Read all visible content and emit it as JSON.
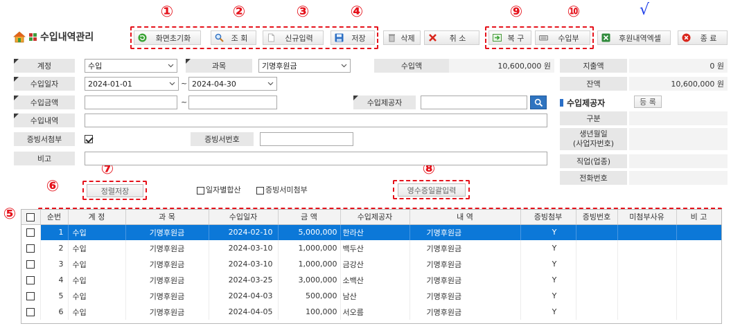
{
  "annotations": {
    "m1": "①",
    "m2": "②",
    "m3": "③",
    "m4": "④",
    "m5": "⑤",
    "m6": "⑥",
    "m7": "⑦",
    "m8": "⑧",
    "m9": "⑨",
    "m10": "⑩",
    "check": "√"
  },
  "header": {
    "title": "수입내역관리",
    "home_icon": "home-icon",
    "menu_icon": "grid-icon"
  },
  "toolbar": {
    "reset": {
      "label": "화면초기화",
      "icon": "refresh-icon"
    },
    "search": {
      "label": "조 회",
      "icon": "search-icon"
    },
    "new": {
      "label": "신규입력",
      "icon": "new-document-icon"
    },
    "save": {
      "label": "저장",
      "icon": "save-icon"
    },
    "delete": {
      "label": "삭제",
      "icon": "trash-icon"
    },
    "cancel": {
      "label": "취 소",
      "icon": "close-icon"
    },
    "restore": {
      "label": "복 구",
      "icon": "restore-icon"
    },
    "ledger": {
      "label": "수입부",
      "icon": "keyboard-icon"
    },
    "excel": {
      "label": "후원내역엑셀",
      "icon": "excel-icon"
    },
    "exit": {
      "label": "종 료",
      "icon": "exit-icon"
    }
  },
  "filters": {
    "account": {
      "label": "계정",
      "value": "수입"
    },
    "subject": {
      "label": "과목",
      "value": "기명후원금"
    },
    "date": {
      "label": "수입일자",
      "from": "2024-01-01",
      "to": "2024-04-30",
      "sep": "~"
    },
    "amount": {
      "label": "수입금액",
      "from": "",
      "to": "",
      "sep": "~"
    },
    "provider": {
      "label": "수입제공자",
      "value": ""
    },
    "details": {
      "label": "수입내역",
      "value": ""
    },
    "evidence": {
      "label": "증빙서첨부",
      "checked": true
    },
    "evidence_no": {
      "label": "증빙서번호",
      "value": ""
    },
    "note": {
      "label": "비고",
      "value": ""
    }
  },
  "summary": {
    "income": {
      "label": "수입액",
      "value": "10,600,000 원"
    },
    "expense": {
      "label": "지출액",
      "value": "0 원"
    },
    "balance": {
      "label": "잔액",
      "value": "10,600,000 원"
    }
  },
  "provider_panel": {
    "title": "수입제공자",
    "register": "등 록",
    "category": {
      "label": "구분",
      "value": ""
    },
    "birth": {
      "label_line1": "생년월일",
      "label_line2": "(사업자번호)",
      "value": ""
    },
    "job": {
      "label": "직업(업종)",
      "value": ""
    },
    "phone": {
      "label": "전화번호",
      "value": ""
    }
  },
  "options": {
    "sort_save": "정렬저장",
    "daily_sum": {
      "label": "일자별합산",
      "checked": false
    },
    "no_evidence": {
      "label": "증빙서미첨부",
      "checked": false
    },
    "receipt_batch": "영수증일괄입력"
  },
  "table": {
    "columns": [
      "순번",
      "계 정",
      "과 목",
      "수입일자",
      "금 액",
      "수입제공자",
      "내 역",
      "증빙첨부",
      "증빙번호",
      "미첨부사유",
      "비 고"
    ],
    "selected_row": 0,
    "rows": [
      [
        "1",
        "수입",
        "기명후원금",
        "2024-02-10",
        "5,000,000",
        "한라산",
        "기명후원금",
        "Y",
        "",
        "",
        ""
      ],
      [
        "2",
        "수입",
        "기명후원금",
        "2024-03-10",
        "1,000,000",
        "백두산",
        "기명후원금",
        "Y",
        "",
        "",
        ""
      ],
      [
        "3",
        "수입",
        "기명후원금",
        "2024-03-10",
        "1,000,000",
        "금강산",
        "기명후원금",
        "Y",
        "",
        "",
        ""
      ],
      [
        "4",
        "수입",
        "기명후원금",
        "2024-03-25",
        "3,000,000",
        "소백산",
        "기명후원금",
        "Y",
        "",
        "",
        ""
      ],
      [
        "5",
        "수입",
        "기명후원금",
        "2024-04-03",
        "500,000",
        "남산",
        "기명후원금",
        "Y",
        "",
        "",
        ""
      ],
      [
        "6",
        "수입",
        "기명후원금",
        "2024-04-05",
        "100,000",
        "서오름",
        "기명후원금",
        "Y",
        "",
        "",
        ""
      ]
    ]
  },
  "colors": {
    "selection": "#0c78d8",
    "annotation": "#e5121b",
    "check": "#1f3fe8"
  }
}
